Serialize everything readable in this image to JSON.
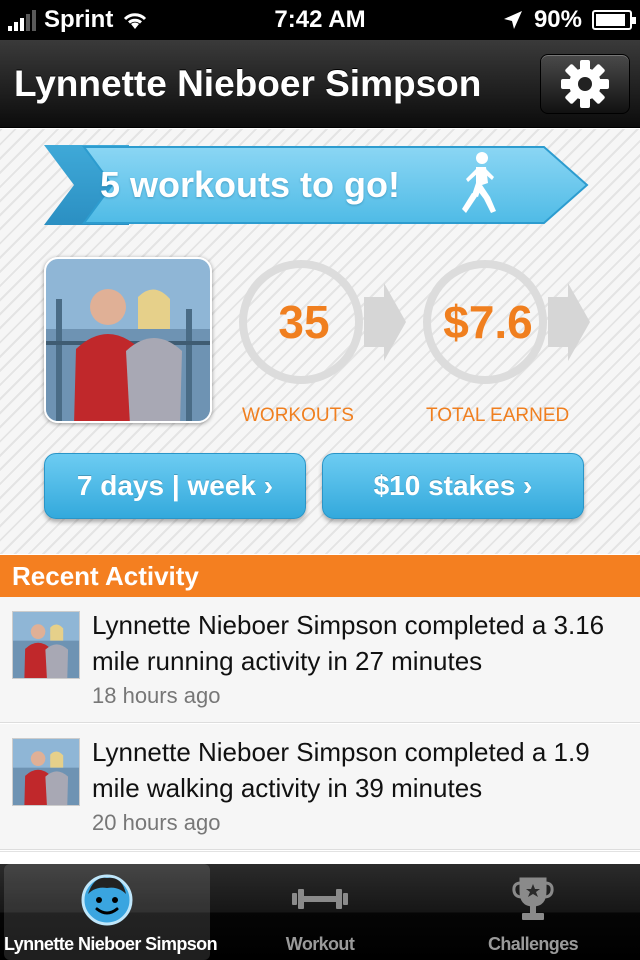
{
  "status_bar": {
    "carrier": "Sprint",
    "time": "7:42 AM",
    "battery": "90%",
    "battery_level": 0.9
  },
  "nav": {
    "title": "Lynnette Nieboer Simpson",
    "settings_icon": "gear-icon"
  },
  "goal_banner": {
    "text": "5 workouts to go!",
    "icon": "runner-icon"
  },
  "stats": [
    {
      "value": "35",
      "label": "WORKOUTS"
    },
    {
      "value": "$7.6",
      "label": "TOTAL EARNED"
    }
  ],
  "buttons": {
    "schedule": "7 days | week ›",
    "stakes": "$10 stakes ›"
  },
  "recent_activity": {
    "header": "Recent Activity",
    "items": [
      {
        "text": "Lynnette Nieboer Simpson completed a 3.16 mile running activity in 27 minutes",
        "time_ago": "18 hours ago"
      },
      {
        "text": "Lynnette Nieboer Simpson completed a 1.9 mile walking activity in 39 minutes",
        "time_ago": "20 hours ago"
      }
    ]
  },
  "tab_bar": {
    "tabs": [
      {
        "label": "Lynnette Nieboer Simpson",
        "icon": "profile-face-icon",
        "active": true
      },
      {
        "label": "Workout",
        "icon": "dumbbell-icon",
        "active": false
      },
      {
        "label": "Challenges",
        "icon": "trophy-icon",
        "active": false
      }
    ]
  },
  "colors": {
    "accent_orange": "#f47f20",
    "accent_blue": "#3fb3e4",
    "stat_orange": "#f07f1f"
  }
}
